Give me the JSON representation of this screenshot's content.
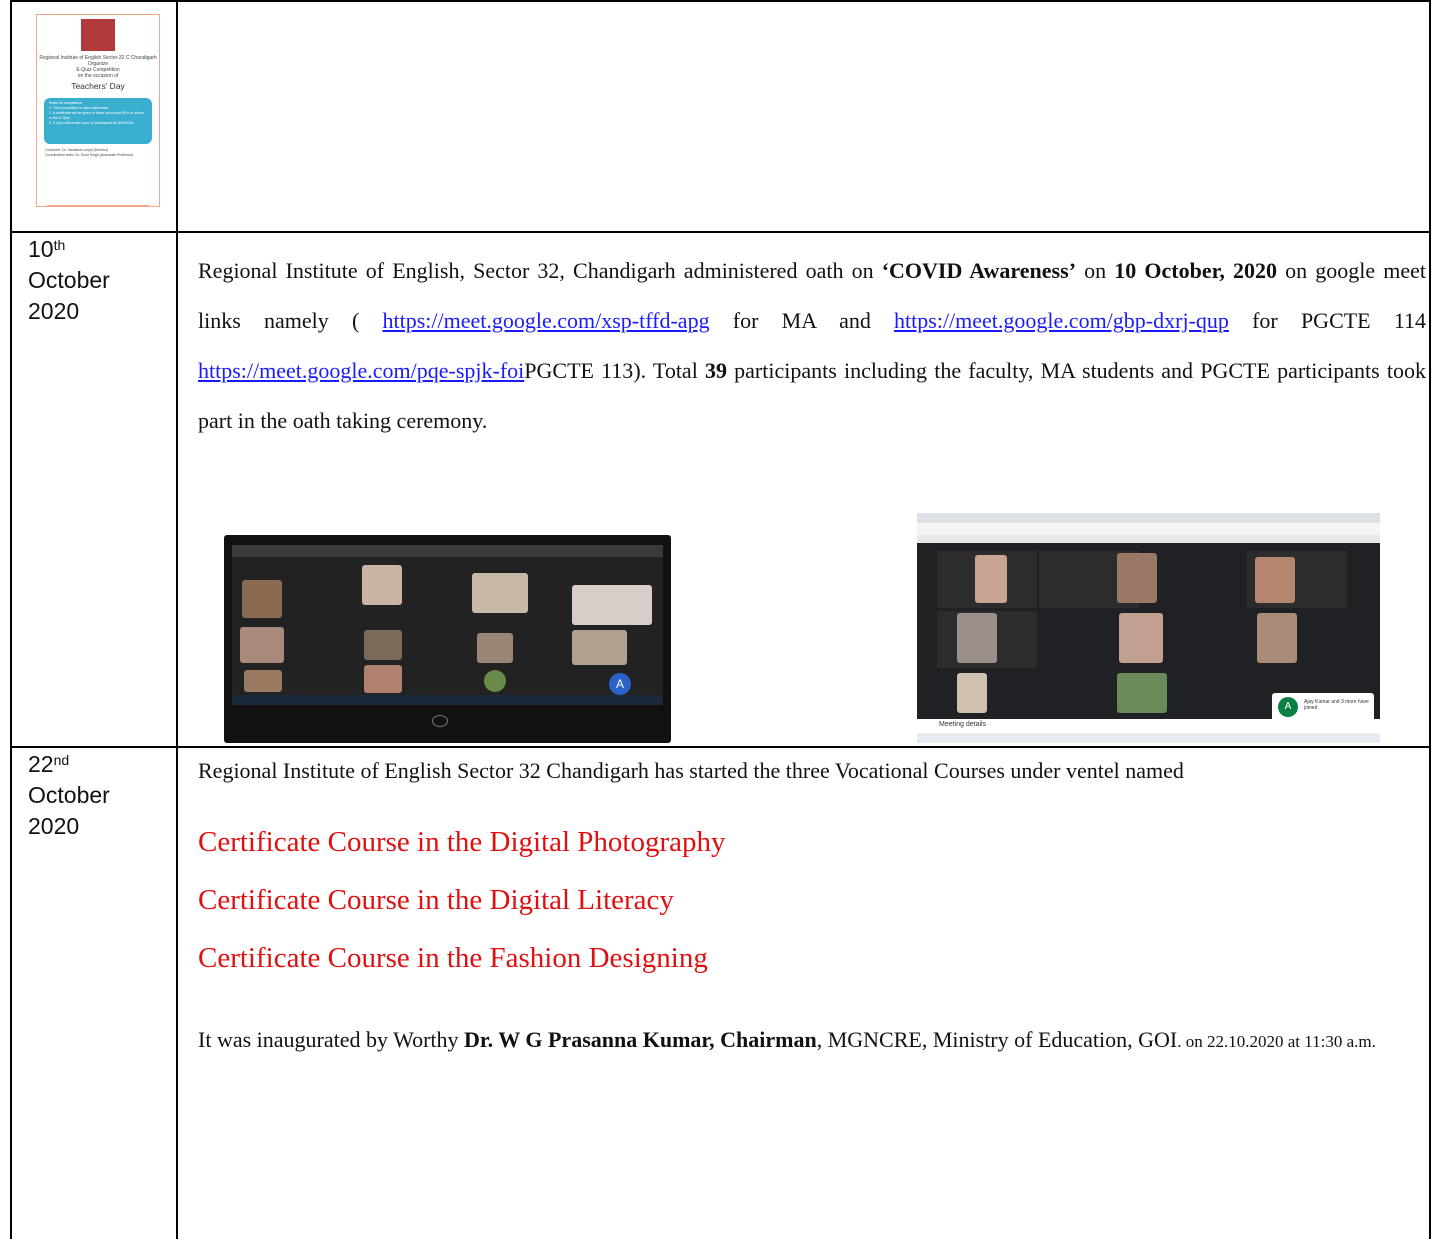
{
  "poster": {
    "institute": "Regional Institute of English Sector-32 C Chandigarh",
    "organize": "Organize",
    "event": "E-Quiz Competition",
    "occasion": "on the occasion of",
    "title": "Teachers' Day",
    "rules_heading": "Rules for competition",
    "rule_1": "1. This competition is open nationwide.",
    "rule_2": "2. A certificate will be given to those who score 80% or above in this E-Quiz.",
    "rule_3": "3. E-Quiz will remain open to participants till 8/09/2020.",
    "convener": "Convener: Dr. Vandana Lunyal (Director)",
    "coordination": "Coordination team: Dr. Sunil Singh (Associate Professor)"
  },
  "rows": [
    {
      "date_day": "10",
      "date_suffix": "th",
      "date_month": "October",
      "date_year": "2020",
      "t1": "Regional Institute of English, Sector 32, Chandigarh administered oath on ",
      "q1": "‘",
      "b1": "COVID Awareness",
      "q2": "’",
      "t2": "on ",
      "b2": "10 October, 2020",
      "t3": " on google meet links namely ",
      "paren1": "(",
      "link1": "https://meet.google.com/xsp-tffd-apg",
      "t4": " for MA  and ",
      "link2": "https://meet.google.com/gbp-dxrj-qup",
      "t5": " for  PGCTE  114 ",
      "link3": "https://meet.google.com/pqe-spjk-foi",
      "t6": "PGCTE 113",
      "paren2": ").",
      "t7": "  Total ",
      "b3": "39",
      "t8": " participants including the faculty, MA students and PGCTE participants took part in the oath taking ceremony."
    },
    {
      "date_day": "22",
      "date_suffix": "nd",
      "date_month": "October",
      "date_year": "2020",
      "intro": "Regional Institute of English Sector 32 Chandigarh has started the three Vocational Courses under ventel named",
      "courses": [
        "Certificate Course in the Digital Photography",
        "Certificate Course in the Digital Literacy",
        "Certificate Course in the Fashion Designing"
      ],
      "i1": "It was inaugurated by Worthy ",
      "ib1": "Dr.  W G Prasanna Kumar, Chairman",
      "i2": ", MGNCRE, Ministry of Education, GOI",
      "i3": ".  on 22.10.2020 at 11:30 a.m."
    }
  ],
  "screenshot_right": {
    "meeting_details": "Meeting details",
    "notice": "Ajay Kumar and 3 more have joined"
  },
  "colors": {
    "link": "#1a1aff",
    "course": "#e01010",
    "poster_blue": "#3aaecf"
  }
}
